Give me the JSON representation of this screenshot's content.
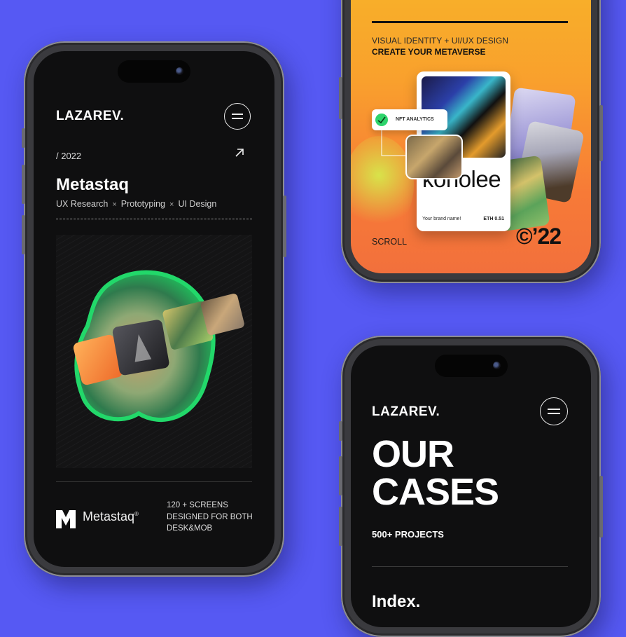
{
  "colors": {
    "background": "#5659f3",
    "screen_dark": "#0f0f10",
    "accent_orange": "#f9a02d",
    "nft_green": "#2ed46c"
  },
  "phone_left": {
    "logo": "LAZAREV.",
    "year": "/ 2022",
    "title": "Metastaq",
    "tags": [
      "UX Research",
      "Prototyping",
      "UI Design"
    ],
    "tag_separator": "×",
    "brand_name": "Metastaq",
    "brand_mark": "®",
    "description_lines": [
      "120 + SCREENS",
      "DESIGNED FOR BOTH",
      "DESK&MOB"
    ],
    "icons": {
      "menu": "menu-icon",
      "arrow": "arrow-up-right-icon",
      "brand": "metastaq-logo-icon"
    }
  },
  "phone_top_right": {
    "subtitle_line1": "VISUAL IDENTITY + UI/UX DESIGN",
    "subtitle_line2": "CREATE YOUR METAVERSE",
    "nft_label": "NFT ANALYTICS",
    "card_title": "konolee",
    "card_brand": "Your brand name!",
    "card_price": "ETH 0.51",
    "scroll_label": "SCROLL",
    "year_mark": "©’22"
  },
  "phone_bottom_right": {
    "logo": "LAZAREV.",
    "heading_line1": "OUR",
    "heading_line2": "CASES",
    "projects": "500+ PROJECTS",
    "index": "Index."
  }
}
